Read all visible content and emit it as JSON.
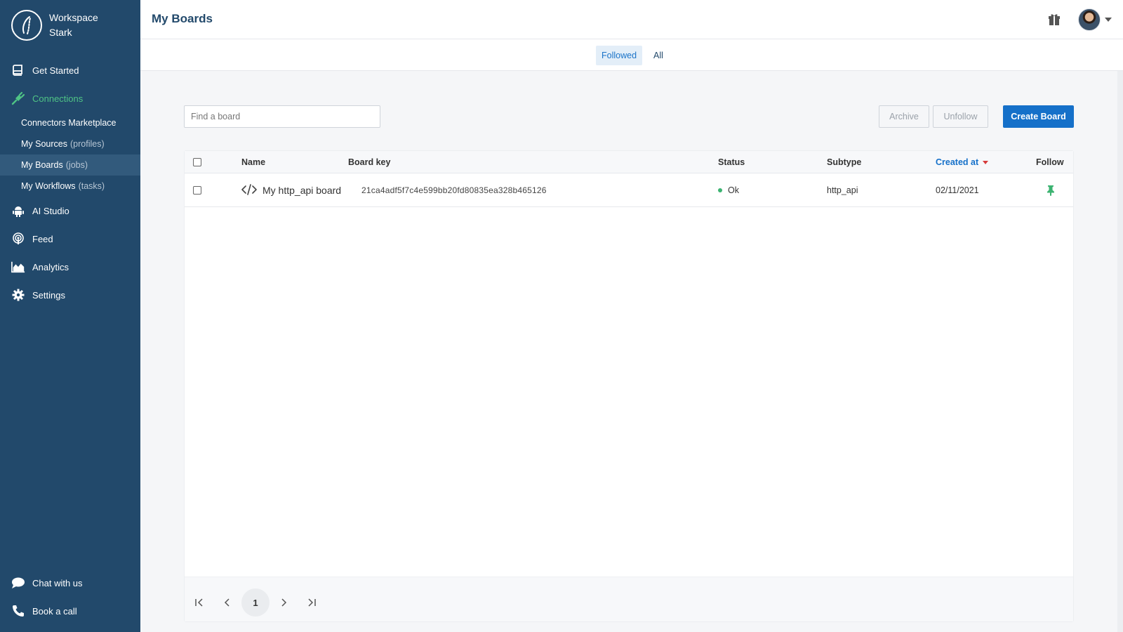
{
  "sidebar": {
    "workspace_line1": "Workspace",
    "workspace_line2": "Stark",
    "items": [
      {
        "label": "Get Started",
        "icon": "book-icon"
      },
      {
        "label": "Connections",
        "icon": "plug-icon"
      },
      {
        "label": "AI Studio",
        "icon": "android-icon"
      },
      {
        "label": "Feed",
        "icon": "podcast-icon"
      },
      {
        "label": "Analytics",
        "icon": "area-chart-icon"
      },
      {
        "label": "Settings",
        "icon": "gear-icon"
      }
    ],
    "sub_items": [
      {
        "label": "Connectors Marketplace",
        "hint": ""
      },
      {
        "label": "My Sources",
        "hint": "(profiles)"
      },
      {
        "label": "My Boards",
        "hint": "(jobs)"
      },
      {
        "label": "My Workflows",
        "hint": "(tasks)"
      }
    ],
    "bottom": [
      {
        "label": "Chat with us",
        "icon": "chat-icon"
      },
      {
        "label": "Book a call",
        "icon": "phone-icon"
      }
    ]
  },
  "header": {
    "title": "My Boards"
  },
  "tabs": [
    {
      "label": "Followed",
      "active": true
    },
    {
      "label": "All",
      "active": false
    }
  ],
  "toolbar": {
    "search_placeholder": "Find a board",
    "archive_label": "Archive",
    "unfollow_label": "Unfollow",
    "create_label": "Create Board"
  },
  "table": {
    "columns": [
      "Name",
      "Board key",
      "Status",
      "Subtype",
      "Created at",
      "Follow"
    ],
    "sorted_column": "Created at",
    "rows": [
      {
        "name": "My http_api board",
        "board_key": "21ca4adf5f7c4e599bb20fd80835ea328b465126",
        "status": "Ok",
        "subtype": "http_api",
        "created_at": "02/11/2021"
      }
    ]
  },
  "pagination": {
    "current_page": "1"
  },
  "colors": {
    "sidebar_bg": "#22496b",
    "accent_green": "#4fc485",
    "primary_blue": "#1570c9"
  }
}
